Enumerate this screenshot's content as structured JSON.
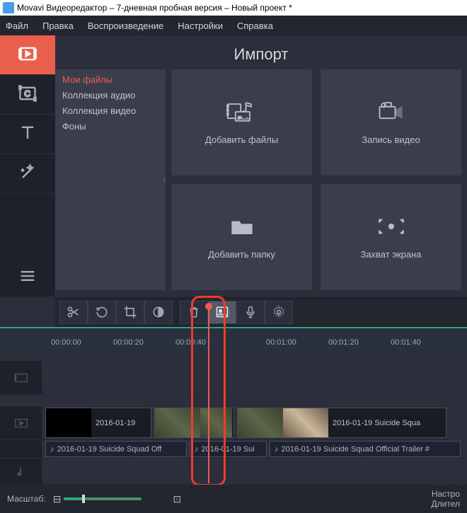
{
  "title": "Movavi Видеоредактор – 7-дневная пробная версия – Новый проект *",
  "menu": {
    "file": "Файл",
    "edit": "Правка",
    "play": "Воспроизведение",
    "settings": "Настройки",
    "help": "Справка"
  },
  "section_title": "Импорт",
  "sources": {
    "my_files": "Мои файлы",
    "audio": "Коллекция аудио",
    "video": "Коллекция видео",
    "backgrounds": "Фоны"
  },
  "tiles": {
    "add_files": "Добавить файлы",
    "record_video": "Запись видео",
    "add_folder": "Добавить папку",
    "screen_capture": "Захват экрана"
  },
  "ruler": {
    "t0": "00:00:00",
    "t1": "00:00:20",
    "t2": "00:00:40",
    "t3": "00:01:00",
    "t4": "00:01:20",
    "t5": "00:01:40"
  },
  "clips": {
    "v1_label": "2016-01-19",
    "v2_label": "2016-01-19 Suicide Squa",
    "a1": "2016-01-19 Suicide Squad Off",
    "a2": "2016-01-19 Sui",
    "a3": "2016-01-19 Suicide Squad Official Trailer #"
  },
  "footer": {
    "zoom_label": "Масштаб:",
    "settings": "Настро",
    "duration": "Длител"
  }
}
